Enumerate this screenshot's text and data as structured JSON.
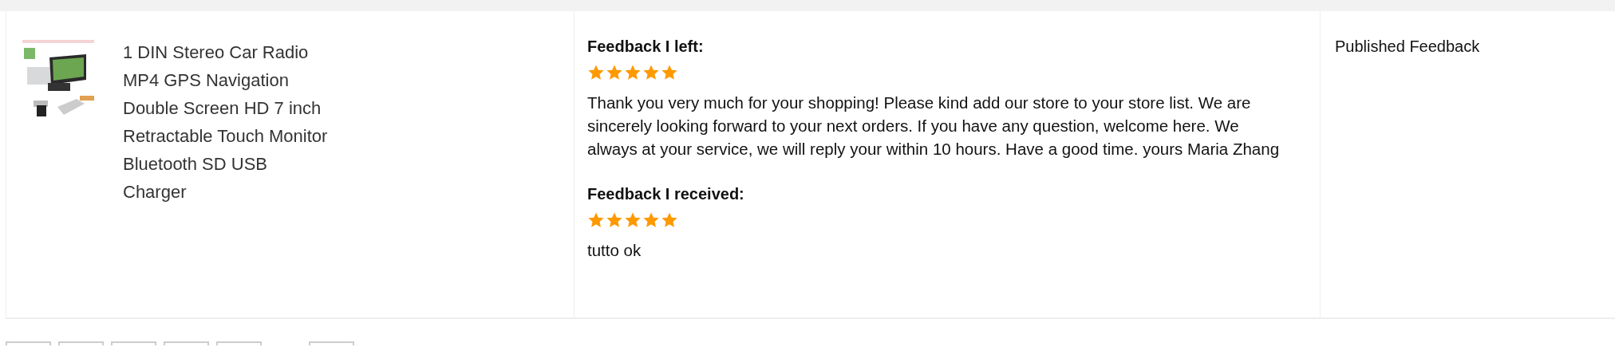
{
  "order_item": {
    "product": {
      "title": "1 DIN Stereo Car Radio MP4 GPS Navigation Double Screen HD 7 inch Retractable Touch Monitor Bluetooth SD USB Charger"
    },
    "feedback": [
      {
        "heading": "Feedback I left:",
        "stars": 5,
        "text": "Thank you very much for your shopping! Please kind add our store to your store list. We are sincerely looking forward to your next orders. If you have any question, welcome here. We always at your service, we will reply your within 10 hours. Have a good time. yours Maria Zhang"
      },
      {
        "heading": "Feedback I received:",
        "stars": 5,
        "text": "tutto ok"
      }
    ],
    "status": "Published Feedback"
  },
  "pagination": [
    {
      "kind": "page_button"
    },
    {
      "kind": "page_button"
    },
    {
      "kind": "page_button"
    },
    {
      "kind": "page_button"
    },
    {
      "kind": "page_button"
    },
    {
      "kind": "gap"
    },
    {
      "kind": "page_button"
    }
  ]
}
